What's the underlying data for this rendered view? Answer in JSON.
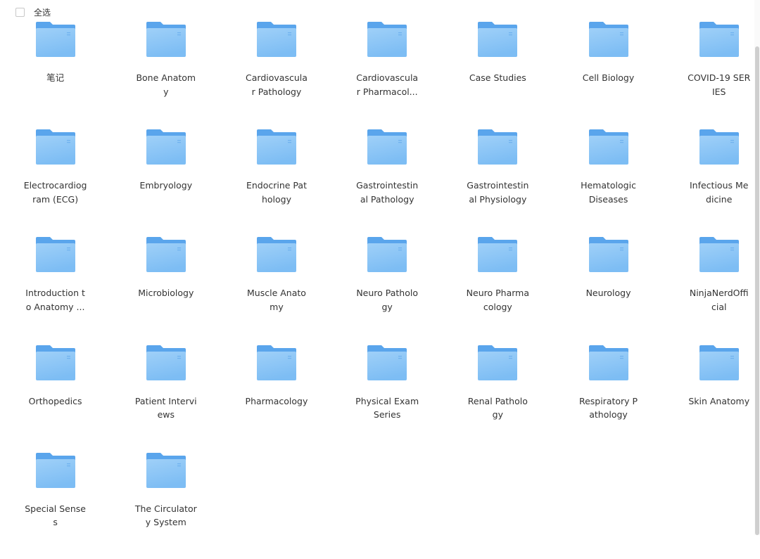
{
  "toolbar": {
    "select_all_label": "全选",
    "select_all_checked": false
  },
  "colors": {
    "folder_back": "#5aa5ec",
    "folder_front_top": "#9fd0f8",
    "folder_front_bottom": "#7dbdf4"
  },
  "folder_icon_name": "folder-icon",
  "folders": [
    {
      "name": "笔记"
    },
    {
      "name": "Bone Anatomy"
    },
    {
      "name": "Cardiovascular Pathology"
    },
    {
      "name": "Cardiovascular Pharmacol..."
    },
    {
      "name": "Case Studies"
    },
    {
      "name": "Cell Biology"
    },
    {
      "name": "COVID-19 SERIES"
    },
    {
      "name": "Electrocardiogram (ECG)"
    },
    {
      "name": "Embryology"
    },
    {
      "name": "Endocrine Pathology"
    },
    {
      "name": "Gastrointestinal Pathology"
    },
    {
      "name": "Gastrointestinal Physiology"
    },
    {
      "name": "Hematologic Diseases"
    },
    {
      "name": "Infectious Medicine"
    },
    {
      "name": "Introduction to Anatomy ..."
    },
    {
      "name": "Microbiology"
    },
    {
      "name": "Muscle Anatomy"
    },
    {
      "name": "Neuro Pathology"
    },
    {
      "name": "Neuro Pharmacology"
    },
    {
      "name": "Neurology"
    },
    {
      "name": "NinjaNerdOfficial"
    },
    {
      "name": "Orthopedics"
    },
    {
      "name": "Patient Interviews"
    },
    {
      "name": "Pharmacology"
    },
    {
      "name": "Physical Exam Series"
    },
    {
      "name": "Renal Pathology"
    },
    {
      "name": "Respiratory Pathology"
    },
    {
      "name": "Skin Anatomy"
    },
    {
      "name": "Special Senses"
    },
    {
      "name": "The Circulatory System"
    }
  ]
}
